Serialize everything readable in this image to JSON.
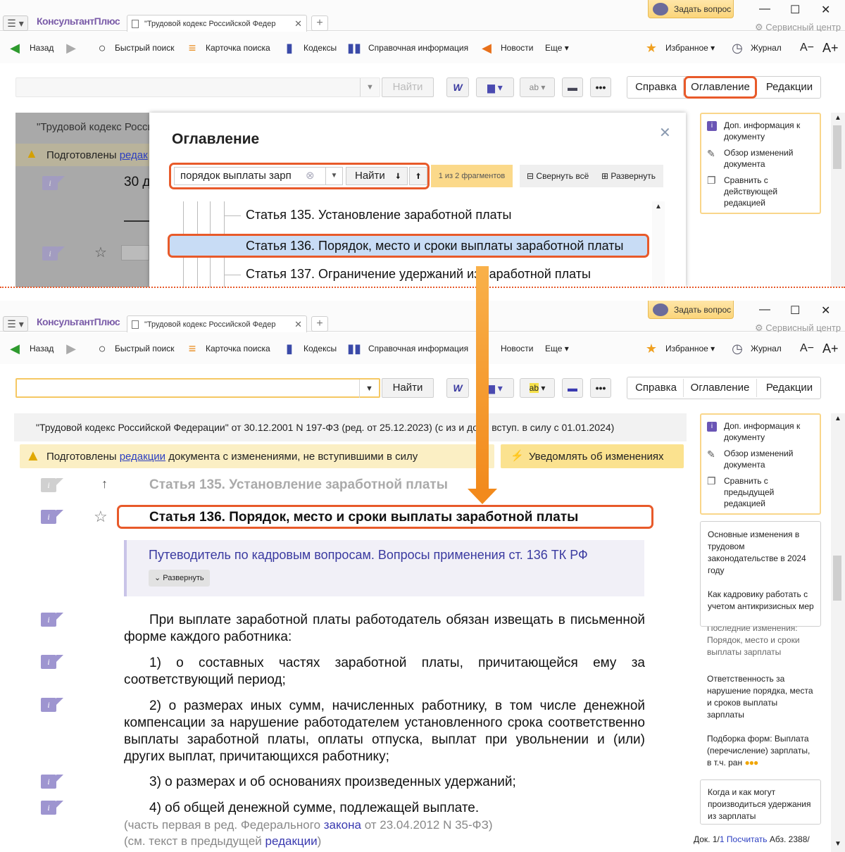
{
  "app": {
    "menu": "☰ ▾",
    "logo": "КонсультантПлюс",
    "tab_title": "\"Трудовой кодекс Российской Федер",
    "ask_button": "Задать вопрос",
    "service": "Сервисный центр",
    "minimize": "—",
    "maximize": "☐",
    "close": "✕"
  },
  "toolbar": {
    "back": "Назад",
    "quick_search": "Быстрый поиск",
    "search_card": "Карточка поиска",
    "codes": "Кодексы",
    "reference": "Справочная информация",
    "news": "Новости",
    "more": "Еще",
    "favorites": "Избранное",
    "journal": "Журнал",
    "font_smaller": "A−",
    "font_larger": "A+"
  },
  "search": {
    "find": "Найти",
    "word_btn": "W"
  },
  "doc_tabs": {
    "help": "Справка",
    "toc": "Оглавление",
    "editions": "Редакции"
  },
  "top": {
    "doc_header": "\"Трудовой кодекс Росси",
    "warning": "Подготовлены",
    "warning_link": "редак",
    "line30": "30 д",
    "toc": {
      "title": "Оглавление",
      "query": "порядок выплаты зарп",
      "find": "Найти",
      "count": "1 из 2 фрагментов",
      "collapse": "Свернуть всё",
      "expand": "Развернуть",
      "items": [
        "Статья 135. Установление заработной платы",
        "Статья 136. Порядок, место и сроки выплаты заработной платы",
        "Статья 137. Ограничение удержаний из заработной платы"
      ]
    },
    "right_panel": [
      "Доп. информация к документу",
      "Обзор изменений документа",
      "Сравнить с действующей редакцией"
    ]
  },
  "bottom": {
    "doc_header": "\"Трудовой кодекс Российской Федерации\" от 30.12.2001 N 197-ФЗ (ред. от 25.12.2023) (с из   и доп., вступ. в силу с 01.01.2024)",
    "warning_pre": "Подготовлены",
    "warning_link": "редакции",
    "warning_post": "документа с изменениями, не вступившими в силу",
    "notify": "Уведомлять об изменениях",
    "art135": "Статья 135. Установление заработной платы",
    "art136": "Статья 136. Порядок, место и сроки выплаты заработной платы",
    "guide": "Путеводитель по кадровым вопросам. Вопросы применения ст. 136 ТК РФ",
    "guide_expand": "Развернуть",
    "paragraphs": [
      "При выплате заработной платы работодатель обязан извещать в письменной форме каждого работника:",
      "1) о составных частях заработной платы, причитающейся ему за соответствующий период;",
      "2) о размерах иных сумм, начисленных работнику, в том числе денежной компенсации за нарушение работодателем установленного срока соответственно выплаты заработной платы, оплаты отпуска, выплат при увольнении и (или) других выплат, причитающихся работнику;",
      "3) о размерах и об основаниях произведенных удержаний;",
      "4) об общей денежной сумме, подлежащей выплате."
    ],
    "note1_pre": "(часть первая в ред. Федерального",
    "note1_link": "закона",
    "note1_post": "от 23.04.2012 N 35-ФЗ)",
    "note2_pre": "(см. текст в предыдущей",
    "note2_link": "редакции",
    "note2_post": ")",
    "right_panel": [
      "Доп. информация к документу",
      "Обзор изменений документа",
      "Сравнить с предыдущей редакцией"
    ],
    "related": [
      "Основные изменения в трудовом законодательстве в 2024 году",
      "Как кадровику работать с учетом антикризисных мер",
      "Последние изменения: Порядок, место и сроки выплаты зарплаты",
      "Ответственность за нарушение порядка, места и сроков выплаты зарплаты",
      "Подборка форм: Выплата (перечисление) зарплаты, в т.ч. ран"
    ],
    "more_dots": "●●●",
    "question": "Когда и как могут производиться удержания из зарплаты",
    "status_doc": "Док. 1/",
    "status_doc_link": "1",
    "status_count": "Посчитать",
    "status_abz": "Абз. 2388/"
  },
  "colors": {
    "accent": "#e85a2a",
    "link": "#2b3ec1",
    "panel_border": "#f9d68a",
    "info_icon": "#9e95d0"
  }
}
